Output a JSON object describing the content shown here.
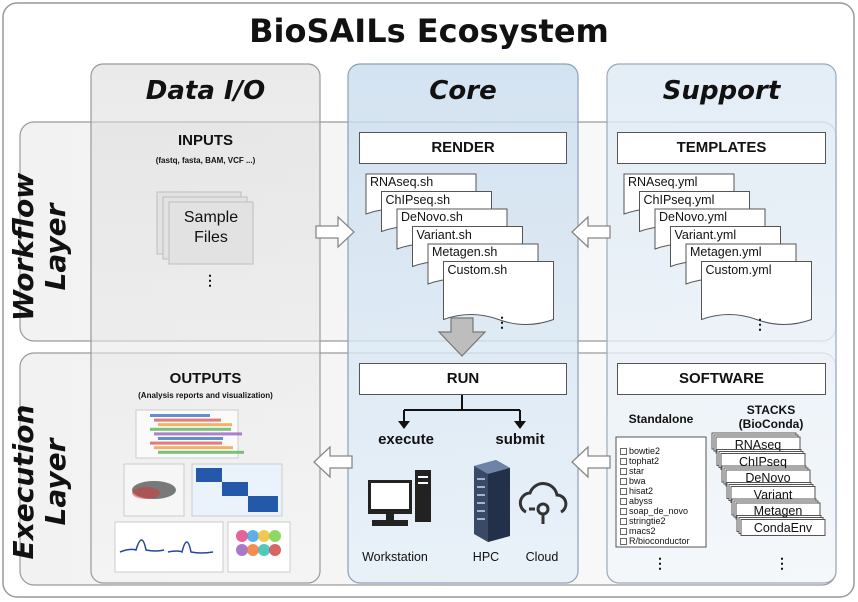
{
  "title": "BioSAILs Ecosystem",
  "columns": {
    "data_io": "Data I/O",
    "core": "Core",
    "support": "Support"
  },
  "rows": {
    "workflow": [
      "Workflow",
      "Layer"
    ],
    "execution": [
      "Execution",
      "Layer"
    ]
  },
  "inputs": {
    "header": "INPUTS",
    "subheader": "(fastq, fasta, BAM, VCF ...)",
    "sample_files": [
      "Sample",
      "Files"
    ],
    "ellipsis": "⋮"
  },
  "render": {
    "label": "RENDER",
    "scripts": [
      "RNAseq.sh",
      "ChIPseq.sh",
      "DeNovo.sh",
      "Variant.sh",
      "Metagen.sh",
      "Custom.sh"
    ],
    "ellipsis": "⋮"
  },
  "templates": {
    "label": "TEMPLATES",
    "files": [
      "RNAseq.yml",
      "ChIPseq.yml",
      "DeNovo.yml",
      "Variant.yml",
      "Metagen.yml",
      "Custom.yml"
    ],
    "ellipsis": "⋮"
  },
  "outputs": {
    "header": "OUTPUTS",
    "subheader": "(Analysis reports and visualization)"
  },
  "run": {
    "label": "RUN",
    "execute": "execute",
    "submit": "submit",
    "workstation": "Workstation",
    "hpc": "HPC",
    "cloud": "Cloud"
  },
  "software": {
    "label": "SOFTWARE",
    "standalone_header": "Standalone",
    "standalone_tools": [
      "bowtie2",
      "tophat2",
      "star",
      "bwa",
      "hisat2",
      "abyss",
      "soap_de_novo",
      "stringtie2",
      "macs2",
      "R/bioconductor"
    ],
    "stacks_header": [
      "STACKS",
      "(BioConda)"
    ],
    "stacks": [
      "RNAseq",
      "ChIPseq",
      "DeNovo",
      "Variant",
      "Metagen",
      "CondaEnv"
    ],
    "ellipsis": "⋮"
  },
  "colors": {
    "core_panel": "#dce9f5",
    "side_panel": "#ececec",
    "support_panel": "#e8f1f8",
    "arrow": "#ffffff"
  }
}
